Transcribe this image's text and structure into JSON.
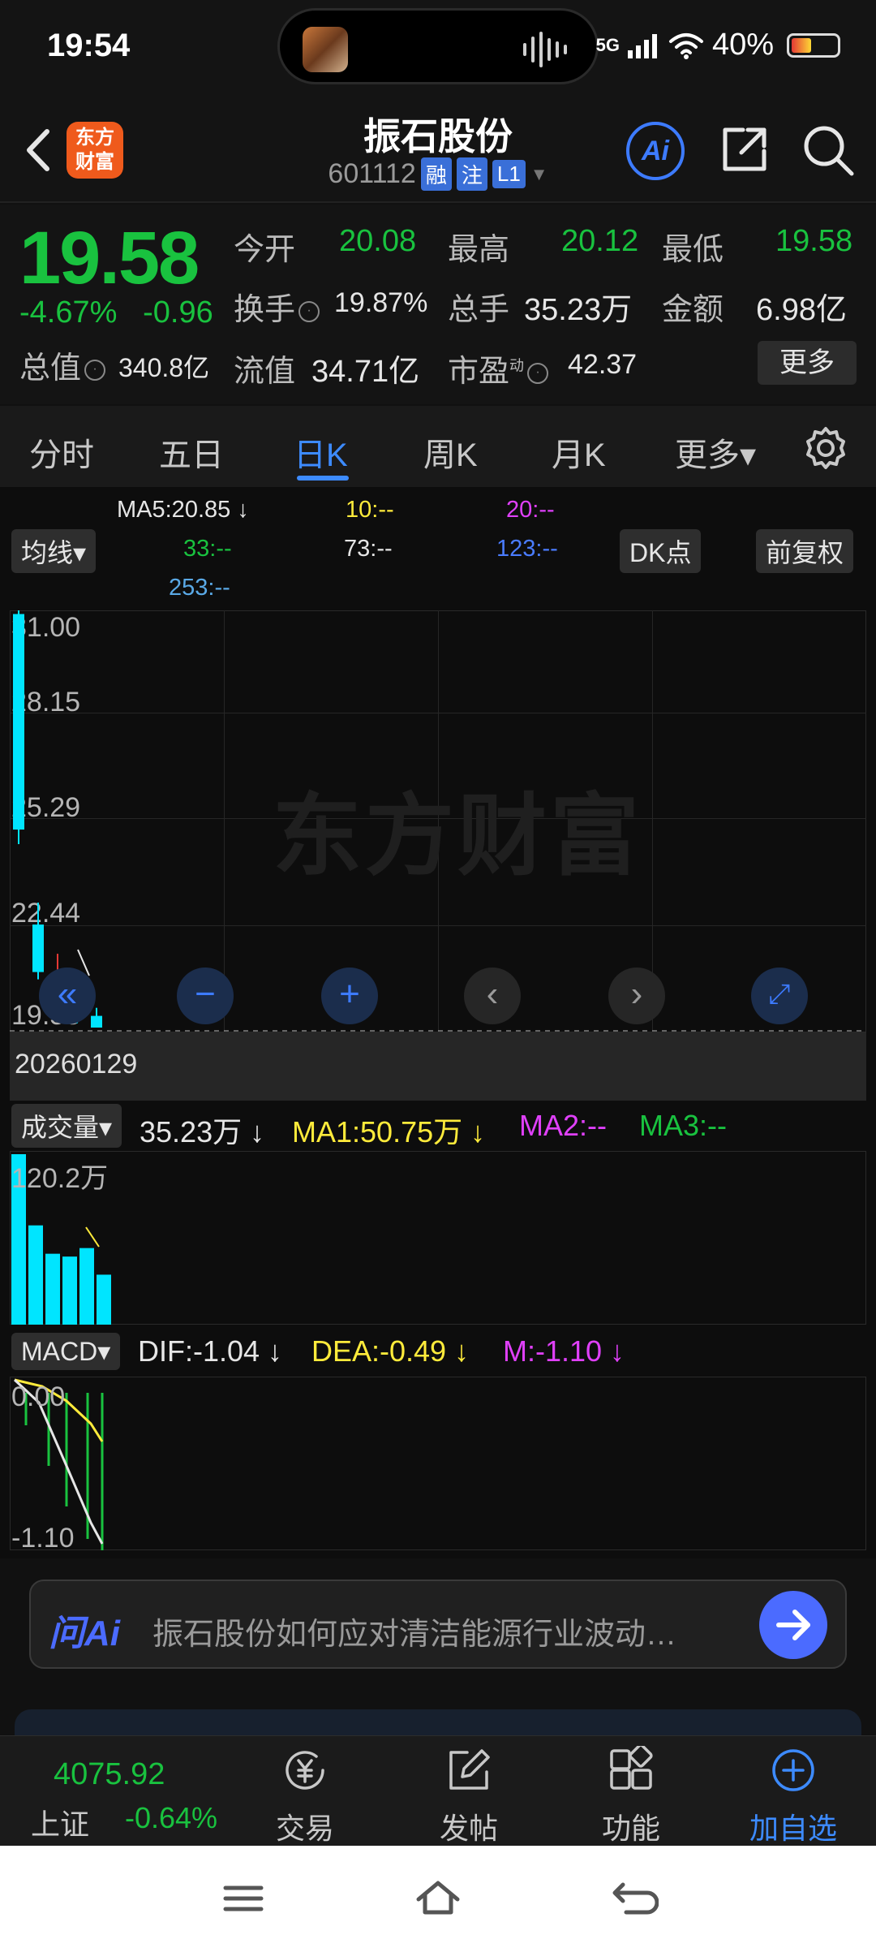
{
  "status": {
    "time": "19:54",
    "network": "5G",
    "battery": "40%"
  },
  "header": {
    "brand": "东方\n财富",
    "stock_name": "振石股份",
    "stock_code": "601112",
    "tags": [
      "融",
      "注",
      "L1"
    ],
    "ai_label": "Ai"
  },
  "quote": {
    "price": "19.58",
    "change_pct": "-4.67%",
    "change_abs": "-0.96",
    "open_label": "今开",
    "open": "20.08",
    "high_label": "最高",
    "high": "20.12",
    "low_label": "最低",
    "low": "19.58",
    "turnover_label": "换手",
    "turnover": "19.87%",
    "volume_label": "总手",
    "volume": "35.23万",
    "amount_label": "金额",
    "amount": "6.98亿",
    "total_cap_label": "总值",
    "total_cap": "340.8亿",
    "float_cap_label": "流值",
    "float_cap": "34.71亿",
    "pe_label": "市盈",
    "pe_sup": "动",
    "pe": "42.37",
    "more_label": "更多"
  },
  "tabs": [
    {
      "label": "分时"
    },
    {
      "label": "五日"
    },
    {
      "label": "日K"
    },
    {
      "label": "周K"
    },
    {
      "label": "月K"
    },
    {
      "label": "更多▾"
    }
  ],
  "kline": {
    "ma5": "MA5:20.85 ↓",
    "ma10": "10:--",
    "ma20": "20:--",
    "ma33": "33:--",
    "ma73": "73:--",
    "ma123": "123:--",
    "ma253": "253:--",
    "indicator_select": "均线▾",
    "dk_label": "DK点",
    "adjust_label": "前复权",
    "y_labels": [
      "31.00",
      "28.15",
      "25.29",
      "22.44",
      "19.58"
    ],
    "date": "20260129",
    "watermark": "东方财富",
    "candles": [
      {
        "open": 30.9,
        "close": 25.0,
        "high": 31.0,
        "low": 24.6
      },
      {
        "open": 22.4,
        "close": 21.1,
        "high": 23.0,
        "low": 20.9
      },
      {
        "open": 20.4,
        "close": 21.0,
        "high": 21.6,
        "low": 20.1
      },
      {
        "open": 20.6,
        "close": 20.0,
        "high": 20.9,
        "low": 19.7
      },
      {
        "open": 19.9,
        "close": 19.58,
        "high": 20.12,
        "low": 19.58
      }
    ]
  },
  "volume": {
    "select": "成交量▾",
    "value": "35.23万 ↓",
    "ma1": "MA1:50.75万 ↓",
    "ma2": "MA2:--",
    "ma3": "MA3:--",
    "y_label": "120.2万",
    "bars": [
      120.2,
      70.0,
      50.0,
      48.0,
      54.0,
      35.23
    ]
  },
  "macd": {
    "select": "MACD▾",
    "dif": "DIF:-1.04 ↓",
    "dea": "DEA:-0.49 ↓",
    "m": "M:-1.10 ↓",
    "y_top": "0.00",
    "y_bottom": "-1.10"
  },
  "ask": {
    "logo": "问Ai",
    "text": "振石股份如何应对清洁能源行业波动…"
  },
  "bottom_nav": {
    "index_value": "4075.92",
    "index_name": "上证",
    "index_change": "-0.64%",
    "items": [
      {
        "label": "交易",
        "icon": "yuan-icon"
      },
      {
        "label": "发帖",
        "icon": "edit-icon"
      },
      {
        "label": "功能",
        "icon": "grid-icon"
      },
      {
        "label": "加自选",
        "icon": "plus-circle-icon"
      }
    ]
  },
  "colors": {
    "down_green": "#19c23f",
    "accent_blue": "#3d8bff",
    "candle_cyan": "#00e5ff",
    "candle_red": "#e53935",
    "ma_yellow": "#ffeb3b",
    "ma_magenta": "#e040fb"
  }
}
